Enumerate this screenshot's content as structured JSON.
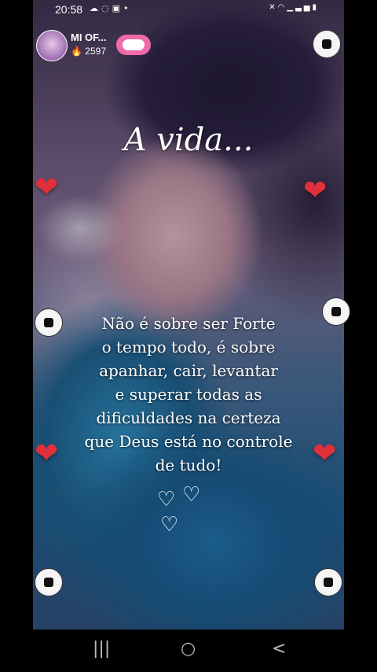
{
  "status_bar": {
    "time": "20:58",
    "left_icons": [
      "cloud-icon",
      "whatsapp-icon",
      "app-icon",
      "dot-icon"
    ],
    "right_icons": [
      "mute-icon",
      "wifi-icon",
      "signal-icon",
      "signal-icon",
      "battery-icon"
    ]
  },
  "profile": {
    "name": "MI OF...",
    "count": "2597"
  },
  "story": {
    "title": "A vida...",
    "quote_lines": [
      "Não é sobre ser Forte",
      "o tempo todo, é sobre",
      "apanhar, cair, levantar",
      "e superar todas as",
      "dificuldades na certeza",
      "que Deus está no controle",
      "de tudo!"
    ]
  },
  "nav": {
    "recents": "|||",
    "home": "○",
    "back": "<"
  }
}
